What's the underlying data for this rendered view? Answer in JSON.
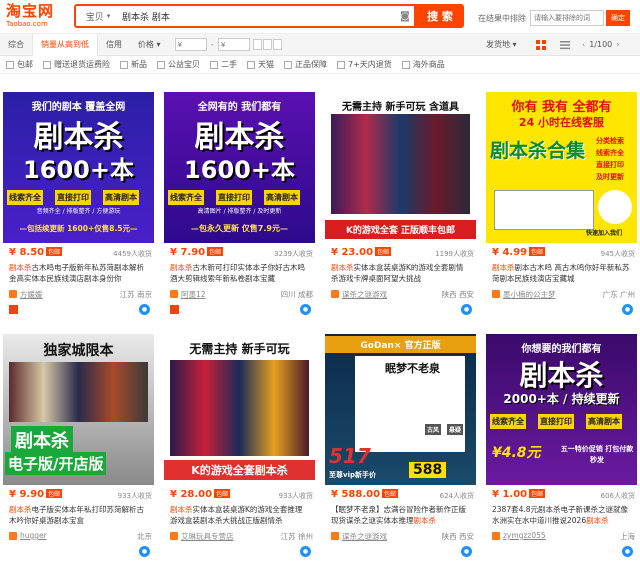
{
  "header": {
    "logo": "淘宝网",
    "logo_sub": "Taobao.com",
    "scope": "宝贝",
    "query": "剧本杀 剧本",
    "search_label": "搜 索",
    "within_label": "在结果中排除",
    "within_placeholder": "请输入要排除的词",
    "ok_label": "确定"
  },
  "sort": {
    "tabs": [
      "综合",
      "销量从高到低",
      "信用",
      "价格"
    ],
    "price_min": "¥",
    "price_max": "¥",
    "ship_label": "发货地",
    "page": "1/100"
  },
  "filters": [
    "包邮",
    "赠送退货运费险",
    "新品",
    "公益宝贝",
    "二手",
    "天猫",
    "正品保障",
    "7+天内退货",
    "海外商品"
  ],
  "colors": {
    "accent": "#ff4400"
  },
  "items": [
    {
      "img_top": "我们的剧本 覆盖全网",
      "img_main": "剧本杀",
      "img_num": "1600+本",
      "img_tags": [
        "线索齐全",
        "直接打印",
        "高清剧本"
      ],
      "img_sub": "音频齐全 / 排版整齐 / 方便游玩",
      "img_bottom": "—包括续更新 1600+仅售8.5元—",
      "price": "¥ 8.50",
      "badge": "包邮",
      "sales": "4459人收货",
      "title_hl": "剧本杀",
      "title": "古木鸣电子版新年私苏菏剧本解析金高实体本民族线演店剧本身份你",
      "shop": "方媛媛",
      "loc": "江苏 南京"
    },
    {
      "img_top": "全网有的 我们都有",
      "img_main": "剧本杀",
      "img_num": "1600+本",
      "img_tags": [
        "线索齐全",
        "直接打印",
        "高清剧本"
      ],
      "img_sub": "高清图片 / 排版整齐 / 及时更新",
      "img_bottom": "—包永久更新 仅售7.9元—",
      "price": "¥ 7.90",
      "badge": "包邮",
      "sales": "3239人收货",
      "title_hl": "剧本杀",
      "title": "古木新可打印实体本子你好古木鸣酒大剪辑线索年新私卷剧本宝藏",
      "shop": "阿墨12",
      "loc": "四川 成都"
    },
    {
      "img_top": "无需主持 新手可玩 含道具",
      "img_bottom": "K的游戏全套 正版顺丰包邮",
      "price": "¥ 23.00",
      "badge": "包邮",
      "sales": "1199人收货",
      "title_hl": "剧本杀",
      "title": "实体本盒装桌游K的游戏全套剧情杀游戏卡牌桌面阿望大挑战",
      "shop": "谋杀之谜游戏",
      "loc": "陕西 西安"
    },
    {
      "img_top": "你有 我有 全都有",
      "img_red": "24 小时在线客服",
      "img_main": "剧本杀合集",
      "img_tags": [
        "分类检索",
        "线索齐全",
        "直接打印",
        "及时更新"
      ],
      "img_note": "快速加入我们",
      "price": "¥ 4.99",
      "badge": "包邮",
      "sales": "945人收货",
      "title_hl": "剧本杀",
      "title": "剧本古木鸣 高古木鸣你好年新私苏菏剧本民族线演店宝藏城",
      "shop": "墨小楠的公主梦",
      "loc": "广东 广州"
    },
    {
      "img_top": "独家城限本",
      "img_main": "剧本杀",
      "img_sub": "电子版/开店版",
      "price": "¥ 9.90",
      "badge": "包邮",
      "sales": "933人收货",
      "title_hl": "剧本杀",
      "title": "电子版实体本年私打印苏菏解析古木吟你好桌游剧本宝盒",
      "shop": "hugger",
      "loc": "北京"
    },
    {
      "img_top": "无需主持 新手可玩",
      "img_bottom": "K的游戏全套剧本杀",
      "price": "¥ 28.00",
      "badge": "包邮",
      "sales": "933人收货",
      "title_hl": "剧本杀",
      "title": "实体本盒装桌游K的游戏全套推理游戏盒装剧本杀大挑战正版剧情杀",
      "shop": "艾琳玩具专营店",
      "loc": "江苏 徐州"
    },
    {
      "img_top": "GoDan× 官方正版",
      "img_main": "眠梦不老泉",
      "img_tags": [
        "古风",
        "悬疑"
      ],
      "img_badge": "517",
      "img_sub": "至尊vip新手价",
      "img_price": "588",
      "price": "¥ 588.00",
      "badge": "包邮",
      "sales": "624人收货",
      "title_hl": "剧本杀",
      "title": "【眠梦不老泉】志满谷冒险作者新作正版现货谋杀之谜实体本推理",
      "shop": "谋杀之谜游戏",
      "loc": "陕西 西安"
    },
    {
      "img_top": "你想要的我们都有",
      "img_main": "剧本杀",
      "img_num": "2000+本 / 持续更新",
      "img_tags": [
        "线索齐全",
        "直接打印",
        "高清剧本"
      ],
      "img_price": "¥4.8元",
      "img_note": "五一特价促销 打包付款秒发",
      "price": "¥ 1.00",
      "badge": "包邮",
      "sales": "606人收货",
      "title_hl": "剧本杀",
      "title": "2387套4.8元剧本杀电子新课杀之谜就像水洲实在水中道川推说2026",
      "shop": "zymgzz055",
      "loc": "上海"
    }
  ]
}
